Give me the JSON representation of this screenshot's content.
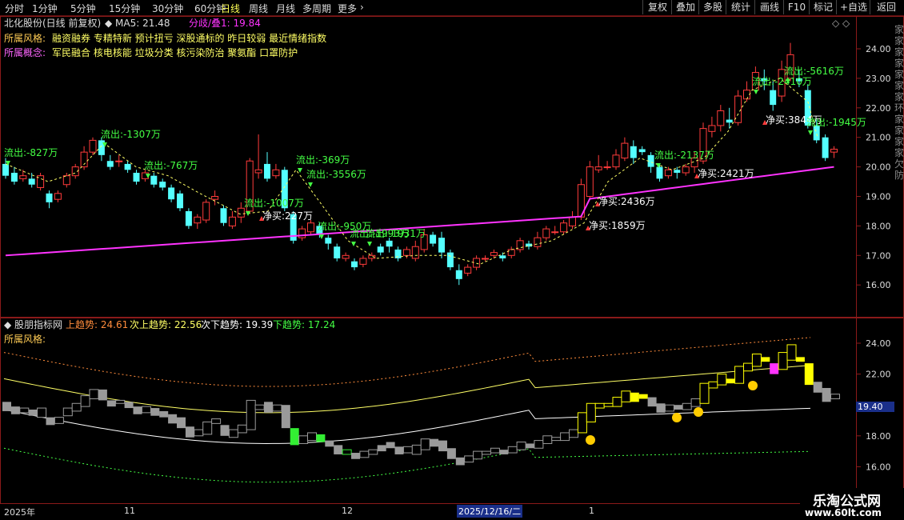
{
  "toolbar": {
    "tabs": [
      "分时",
      "1分钟",
      "5分钟",
      "15分钟",
      "30分钟",
      "60分钟",
      "日线",
      "周线",
      "月线",
      "多周期",
      "更多"
    ],
    "active": "日线",
    "right_buttons": [
      "复权",
      "叠加",
      "多股",
      "统计",
      "画线",
      "F10",
      "标记",
      "+自选",
      "返回"
    ]
  },
  "main": {
    "stock_title": "北化股份(日线 前复权)",
    "ma_label": "MA5: 21.48",
    "divergence_label": "分歧/叠1: 19.84",
    "style_label": "所属风格:",
    "style_text": "融资融券 专精特新 预计扭亏 深股通标的 昨日较弱 最近情绪指数",
    "concept_label": "所属概念:",
    "concept_text": "军民融合 核电核能 垃圾分类 核污染防治 聚氨酯 口罩防护",
    "y_ticks": [
      "24.00",
      "23.00",
      "22.00",
      "21.00",
      "20.00",
      "19.00",
      "18.00",
      "17.00",
      "16.00"
    ],
    "right_edge_text": "家家家家家家家环家家家家欠防"
  },
  "flow_labels": [
    {
      "text": "流出:-827万",
      "kind": "out"
    },
    {
      "text": "流出:-1307万",
      "kind": "out"
    },
    {
      "text": "流出:-767万",
      "kind": "out"
    },
    {
      "text": "流出:-369万",
      "kind": "out"
    },
    {
      "text": "流出:-3556万",
      "kind": "out"
    },
    {
      "text": "流出:-1007万",
      "kind": "out"
    },
    {
      "text": "净买:227万",
      "kind": "in"
    },
    {
      "text": "流出:-950万",
      "kind": "out"
    },
    {
      "text": "流出:-1993万",
      "kind": "out"
    },
    {
      "text": "流出:-1931万",
      "kind": "out"
    },
    {
      "text": "净买:1859万",
      "kind": "in"
    },
    {
      "text": "净买:2436万",
      "kind": "in"
    },
    {
      "text": "流出:-2137万",
      "kind": "out"
    },
    {
      "text": "净买:2421万",
      "kind": "in"
    },
    {
      "text": "流出:-2410万",
      "kind": "out"
    },
    {
      "text": "流出:-5616万",
      "kind": "out"
    },
    {
      "text": "净买:3844万",
      "kind": "in"
    },
    {
      "text": "流出:-1945万",
      "kind": "out"
    }
  ],
  "indicator": {
    "name": "股朋指标网",
    "up_label": "上趋势: 24.61",
    "subup_label": "次上趋势: 22.56",
    "subdown_label": "次下趋势: 19.39",
    "down_label": "下趋势: 17.24",
    "style_label": "所属风格:",
    "y_ticks": [
      "24.00",
      "22.00",
      "20.00",
      "18.00",
      "16.00"
    ],
    "price_tag": "19.40"
  },
  "time_axis": {
    "labels": [
      "2025年",
      "11",
      "12",
      "1"
    ],
    "cursor_date": "2025/12/16/二"
  },
  "watermark": {
    "name": "乐淘公式网",
    "url": "www.60lt.com"
  },
  "colors": {
    "up": "#ff3b3b",
    "down": "#54ffff",
    "ma_line": "#ff33ff",
    "flow_out": "#44ff44",
    "flow_in": "#ffffff",
    "frame": "#8a1a1a",
    "yellow": "#ffff00"
  }
}
